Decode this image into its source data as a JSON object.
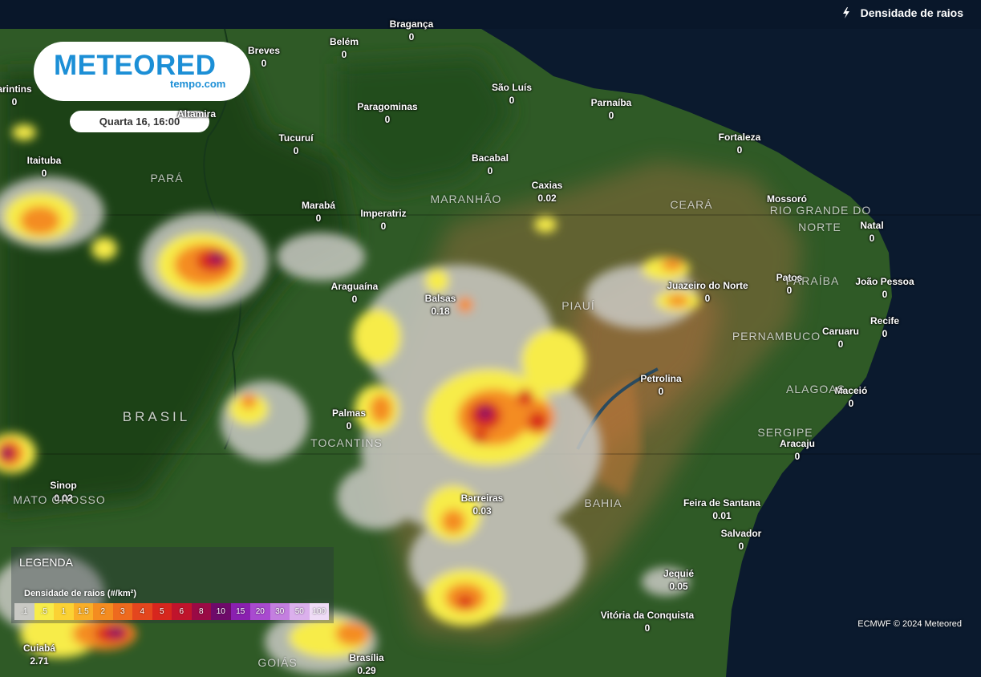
{
  "header": {
    "layer_title": "Densidade de raios",
    "layer_icon": "lightning-icon"
  },
  "logo": {
    "brand": "METEORED",
    "sub": "tempo.com"
  },
  "date_label": "Quarta 16, 16:00",
  "cities": [
    {
      "name": "Bragança",
      "value": "0"
    },
    {
      "name": "Belém",
      "value": "0"
    },
    {
      "name": "Breves",
      "value": "0"
    },
    {
      "name": "arintins",
      "value": "0"
    },
    {
      "name": "Altamira",
      "value": ""
    },
    {
      "name": "São Luís",
      "value": "0"
    },
    {
      "name": "Parnaíba",
      "value": "0"
    },
    {
      "name": "Paragominas",
      "value": "0"
    },
    {
      "name": "Fortaleza",
      "value": "0"
    },
    {
      "name": "Tucuruí",
      "value": "0"
    },
    {
      "name": "Bacabal",
      "value": "0"
    },
    {
      "name": "Itaituba",
      "value": "0"
    },
    {
      "name": "Caxias",
      "value": "0.02"
    },
    {
      "name": "Mossoró",
      "value": ""
    },
    {
      "name": "Marabá",
      "value": "0"
    },
    {
      "name": "Imperatriz",
      "value": "0"
    },
    {
      "name": "Natal",
      "value": "0"
    },
    {
      "name": "Patos",
      "value": "0"
    },
    {
      "name": "João Pessoa",
      "value": "0"
    },
    {
      "name": "Araguaína",
      "value": "0"
    },
    {
      "name": "Balsas",
      "value": "0.18"
    },
    {
      "name": "Juazeiro do Norte",
      "value": "0"
    },
    {
      "name": "Recife",
      "value": "0"
    },
    {
      "name": "Caruaru",
      "value": "0"
    },
    {
      "name": "Petrolina",
      "value": "0"
    },
    {
      "name": "Maceió",
      "value": "0"
    },
    {
      "name": "Palmas",
      "value": "0"
    },
    {
      "name": "Aracaju",
      "value": "0"
    },
    {
      "name": "Sinop",
      "value": "0.02"
    },
    {
      "name": "Barreiras",
      "value": "0.03"
    },
    {
      "name": "Feira de Santana",
      "value": "0.01"
    },
    {
      "name": "Salvador",
      "value": "0"
    },
    {
      "name": "Jequié",
      "value": "0.05"
    },
    {
      "name": "Vitória da Conquista",
      "value": "0"
    },
    {
      "name": "Cuiabá",
      "value": "2.71"
    },
    {
      "name": "Brasília",
      "value": "0.29"
    }
  ],
  "states": [
    "PARÁ",
    "MARANHÃO",
    "CEARÁ",
    "RIO GRANDE DO",
    "NORTE",
    "PARAÍBA",
    "PERNAMBUCO",
    "PIAUÍ",
    "TOCANTINS",
    "ALAGOAS",
    "SERGIPE",
    "BAHIA",
    "MATO GROSSO",
    "GOIÁS"
  ],
  "country": "BRASIL",
  "legend": {
    "title": "LEGENDA",
    "subtitle": "Densidade de raios (#/km²)",
    "items": [
      {
        "label": ".1",
        "color": "#c9c9c4"
      },
      {
        "label": ".5",
        "color": "#f7ec4a"
      },
      {
        "label": "1",
        "color": "#fbd234"
      },
      {
        "label": "1.5",
        "color": "#f9ae28"
      },
      {
        "label": "2",
        "color": "#f48c20"
      },
      {
        "label": "3",
        "color": "#ee6a1e"
      },
      {
        "label": "4",
        "color": "#e4461e"
      },
      {
        "label": "5",
        "color": "#d7261e"
      },
      {
        "label": "6",
        "color": "#c0142c"
      },
      {
        "label": "8",
        "color": "#9a0a45"
      },
      {
        "label": "10",
        "color": "#6e0a6a"
      },
      {
        "label": "15",
        "color": "#8a20b0"
      },
      {
        "label": "20",
        "color": "#a94ad0"
      },
      {
        "label": "30",
        "color": "#c47fe0"
      },
      {
        "label": "50",
        "color": "#dbb0ec"
      },
      {
        "label": "100",
        "color": "#efdcf6"
      }
    ]
  },
  "credit": "ECMWF © 2024 Meteored"
}
